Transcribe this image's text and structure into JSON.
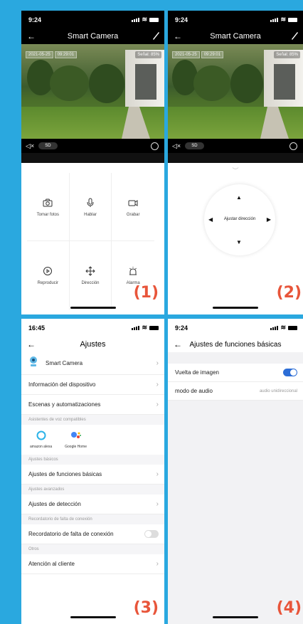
{
  "panel1": {
    "time": "9:24",
    "title": "Smart Camera",
    "date": "2021-05-25",
    "clock": "09:29:01",
    "signal": "Señal: 85%",
    "sd": "SD",
    "actions": [
      {
        "label": "Tomar fotos",
        "icon": "camera-icon"
      },
      {
        "label": "Hablar",
        "icon": "microphone-icon"
      },
      {
        "label": "Grabar",
        "icon": "video-camera-icon"
      },
      {
        "label": "Reproducir",
        "icon": "playback-icon"
      },
      {
        "label": "Dirección",
        "icon": "move-arrows-icon"
      },
      {
        "label": "Alarma",
        "icon": "alarm-icon"
      }
    ],
    "number": "(1)"
  },
  "panel2": {
    "time": "9:24",
    "title": "Smart Camera",
    "date": "2021-05-25",
    "clock": "09:29:01",
    "signal": "Señal: 85%",
    "sd": "SD",
    "ptz_label": "Ajustar dirección",
    "number": "(2)"
  },
  "panel3": {
    "time": "16:45",
    "title": "Ajustes",
    "device_name": "Smart Camera",
    "info": "Información del dispositivo",
    "scenes": "Escenas y automatizaciones",
    "voice_section": "Asistentes de voz compatibles",
    "alexa": "amazon alexa",
    "google": "Google Home",
    "basic_section": "Ajustes básicos",
    "basic": "Ajustes de funciones básicas",
    "advanced_section": "Ajustes avanzados",
    "detection": "Ajustes de detección",
    "offline_section": "Recordatorio de falta de conexión",
    "offline": "Recordatorio de falta de conexión",
    "others_section": "Otros",
    "support": "Atención al cliente",
    "number": "(3)"
  },
  "panel4": {
    "time": "9:24",
    "title": "Ajustes de funciones básicas",
    "flip": "Vuelta de imagen",
    "flip_on": true,
    "audio": "modo de audio",
    "audio_value": "audio unidireccional",
    "number": "(4)"
  },
  "colors": {
    "frame": "#2aa8df",
    "number": "#e8553a",
    "toggle_on": "#2c6dd6"
  }
}
